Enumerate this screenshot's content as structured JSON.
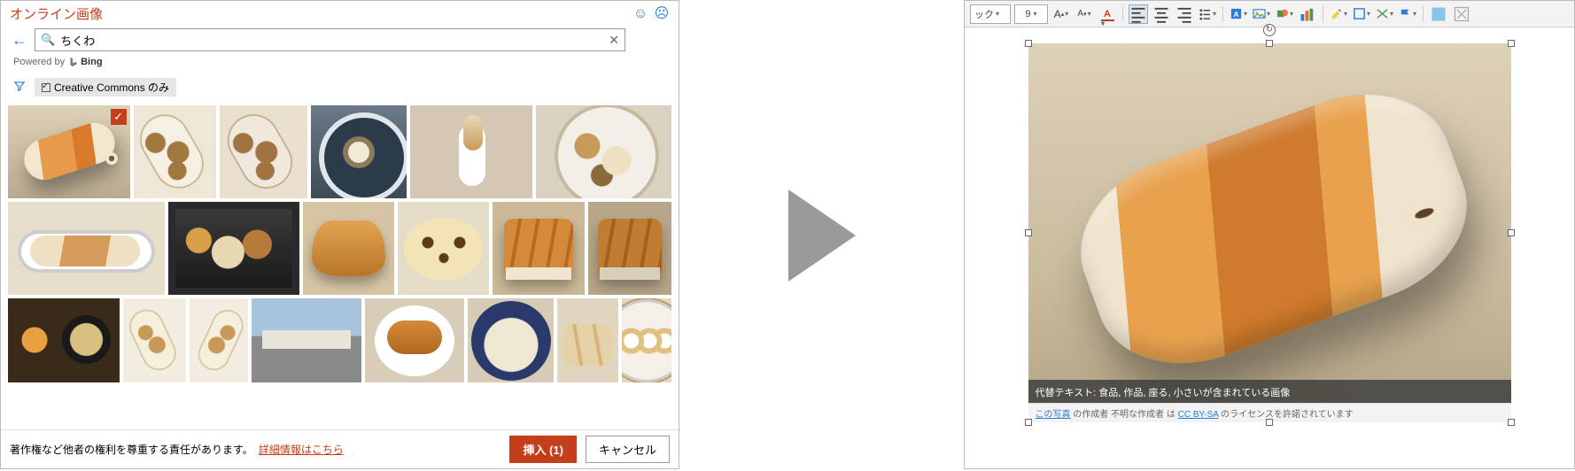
{
  "dialog": {
    "title": "オンライン画像",
    "search_value": "ちくわ",
    "powered_by": "Powered by",
    "bing": "Bing",
    "cc_filter": "Creative Commons のみ",
    "disclaimer": "著作権など他者の権利を尊重する責任があります。",
    "detail_link": "詳細情報はこちら",
    "insert_btn": "挿入 (1)",
    "cancel_btn": "キャンセル"
  },
  "editor": {
    "font_name_hint": "ック",
    "font_size": "9",
    "alt_text": "代替テキスト: 食品, 作品, 座る, 小さいが含まれている画像",
    "attrib_prefix": "この写真",
    "attrib_mid": " の作成者 不明な作成者 は ",
    "attrib_license": "CC BY-SA",
    "attrib_suffix": " のライセンスを許諾されています"
  }
}
